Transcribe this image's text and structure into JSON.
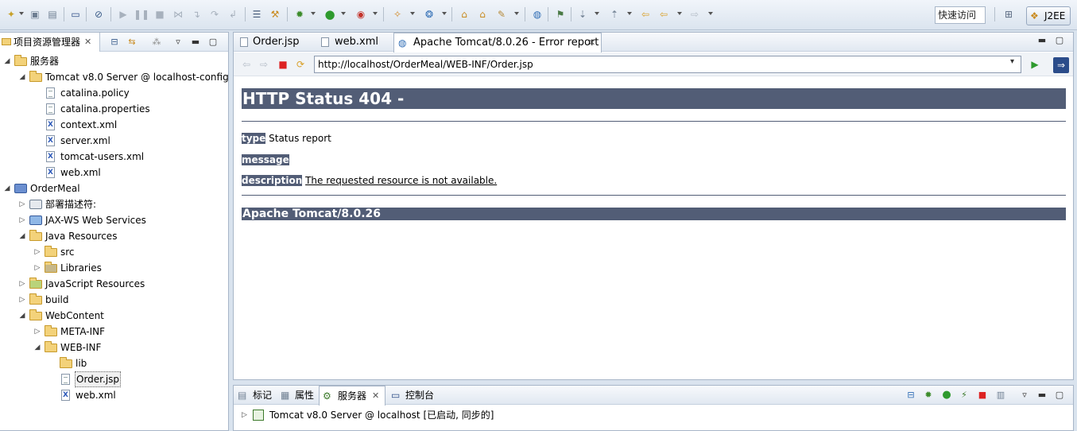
{
  "toolbar": {
    "quick_access": "快速访问",
    "perspective": "J2EE",
    "icons": [
      "new-icon",
      "save-icon",
      "save-all-icon",
      "print-icon",
      "skip-breakpoints-icon",
      "resume-icon",
      "suspend-icon",
      "terminate-icon",
      "disconnect-icon",
      "step-into-icon",
      "step-over-icon",
      "step-return-icon",
      "open-type-icon",
      "build-icon",
      "debug-icon",
      "run-icon",
      "run-server-icon",
      "new-wizard-icon",
      "new-class-icon",
      "open-folder-icon",
      "search-icon",
      "globe-icon",
      "next-annotation-icon",
      "prev-annotation-icon",
      "last-edit-icon",
      "back-icon",
      "forward-icon",
      "open-perspective-icon"
    ]
  },
  "left_panel": {
    "title": "项目资源管理器",
    "tree": [
      {
        "label": "服务器",
        "depth": 0,
        "expand": "open",
        "icon": "folder-icon"
      },
      {
        "label": "Tomcat v8.0 Server @ localhost-config",
        "depth": 1,
        "expand": "open",
        "icon": "folder-icon"
      },
      {
        "label": "catalina.policy",
        "depth": 2,
        "expand": "none",
        "icon": "file-icon"
      },
      {
        "label": "catalina.properties",
        "depth": 2,
        "expand": "none",
        "icon": "file-icon"
      },
      {
        "label": "context.xml",
        "depth": 2,
        "expand": "none",
        "icon": "xml-file-icon"
      },
      {
        "label": "server.xml",
        "depth": 2,
        "expand": "none",
        "icon": "xml-file-icon"
      },
      {
        "label": "tomcat-users.xml",
        "depth": 2,
        "expand": "none",
        "icon": "xml-file-icon"
      },
      {
        "label": "web.xml",
        "depth": 2,
        "expand": "none",
        "icon": "xml-file-icon"
      },
      {
        "label": "OrderMeal",
        "depth": 0,
        "expand": "open",
        "icon": "project-icon"
      },
      {
        "label": "部署描述符:",
        "depth": 1,
        "expand": "closed",
        "icon": "descriptor-icon"
      },
      {
        "label": "JAX-WS Web Services",
        "depth": 1,
        "expand": "closed",
        "icon": "webservice-icon"
      },
      {
        "label": "Java Resources",
        "depth": 1,
        "expand": "open",
        "icon": "java-resources-icon"
      },
      {
        "label": "src",
        "depth": 2,
        "expand": "closed",
        "icon": "package-folder-icon"
      },
      {
        "label": "Libraries",
        "depth": 2,
        "expand": "closed",
        "icon": "library-icon"
      },
      {
        "label": "JavaScript Resources",
        "depth": 1,
        "expand": "closed",
        "icon": "js-resources-icon"
      },
      {
        "label": "build",
        "depth": 1,
        "expand": "closed",
        "icon": "folder-icon"
      },
      {
        "label": "WebContent",
        "depth": 1,
        "expand": "open",
        "icon": "folder-icon"
      },
      {
        "label": "META-INF",
        "depth": 2,
        "expand": "closed",
        "icon": "folder-icon"
      },
      {
        "label": "WEB-INF",
        "depth": 2,
        "expand": "open",
        "icon": "folder-icon"
      },
      {
        "label": "lib",
        "depth": 3,
        "expand": "none",
        "icon": "folder-icon"
      },
      {
        "label": "Order.jsp",
        "depth": 3,
        "expand": "none",
        "icon": "jsp-file-icon",
        "selected": true
      },
      {
        "label": "web.xml",
        "depth": 3,
        "expand": "none",
        "icon": "xml-file-icon"
      }
    ]
  },
  "editor": {
    "tabs": [
      {
        "label": "Order.jsp",
        "active": false
      },
      {
        "label": "web.xml",
        "active": false
      },
      {
        "label": "Apache Tomcat/8.0.26 - Error report",
        "active": true
      }
    ],
    "url": "http://localhost/OrderMeal/WEB-INF/Order.jsp"
  },
  "page": {
    "title": "HTTP Status 404 -",
    "type_label": "type",
    "type_value": "Status report",
    "message_label": "message",
    "description_label": "description",
    "description_value": "The requested resource is not available.",
    "footer": "Apache Tomcat/8.0.26"
  },
  "bottom_panel": {
    "tabs": [
      {
        "label": "标记",
        "active": false
      },
      {
        "label": "属性",
        "active": false
      },
      {
        "label": "服务器",
        "active": true
      },
      {
        "label": "控制台",
        "active": false
      }
    ],
    "server_entry": "Tomcat v8.0 Server @ localhost  [已启动, 同步的]"
  },
  "colors": {
    "accent": "#525d76",
    "panel_border": "#a8b6c8",
    "background": "#d9e3ee"
  }
}
